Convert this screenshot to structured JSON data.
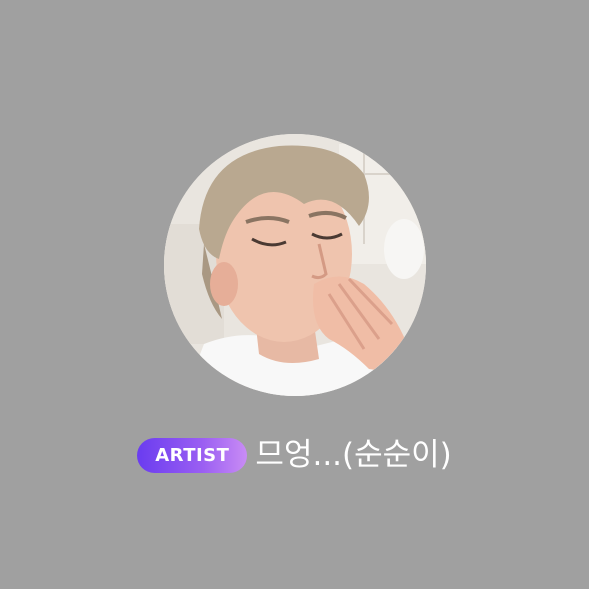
{
  "profile": {
    "badge_label": "ARTIST",
    "username": "므엉...(순순이)",
    "avatar_alt": "profile photo"
  },
  "colors": {
    "background": "#a0a0a0",
    "badge_gradient_start": "#6a3cf0",
    "badge_gradient_end": "#c98cf5",
    "text": "#ffffff"
  }
}
